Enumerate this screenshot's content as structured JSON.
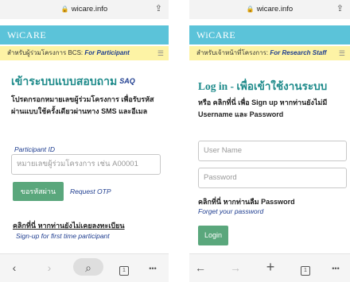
{
  "left": {
    "url": "wicare.info",
    "brand": "WiCARE",
    "role_thai": "สำหรับผู้ร่วมโครงการ BCS:",
    "role_label": "For Participant",
    "title": "เข้าระบบแบบสอบถาม",
    "title_badge": "SAQ",
    "desc": "โปรดกรอกหมายเลขผู้ร่วมโครงการ เพื่อรับรหัสผ่านแบบใช้ครั้งเดียวผ่านทาง SMS และอีเมล",
    "field_label": "Participant ID",
    "field_placeholder": "หมายเลขผู้ร่วมโครงการ เช่น A00001",
    "otp_button": "ขอรหัสผ่าน",
    "request_otp": "Request OTP",
    "register_thai": "คลิกที่นี่ หากท่านยังไม่เคยลงทะเบียน",
    "register_en": "Sign-up for first time participant"
  },
  "right": {
    "url": "wicare.info",
    "brand": "WiCARE",
    "role_thai": "สำหรับเจ้าหน้าที่โครงการ:",
    "role_label": "For Research Staff",
    "title": "Log in - เพื่อเข้าใช้งานระบบ",
    "subtitle": "หรือ คลิกที่นี่ เพื่อ Sign up หากท่านยังไม่มี Username และ Password",
    "username_placeholder": "User Name",
    "password_placeholder": "Password",
    "forgot_thai": "คลิกที่นี่ หากท่านลืม Password",
    "forgot_en": "Forget your password",
    "login_button": "Login"
  },
  "toolbar": {
    "back": "‹",
    "forward": "›",
    "search": "⌕",
    "new_tab": "+",
    "tabs_count": "1",
    "more": "•••"
  },
  "colors": {
    "brand_bar": "#5bc3d9",
    "role_bar": "#fdf3a5",
    "title": "#1d8a8a",
    "link": "#1d3c8f",
    "button": "#5aa77c"
  }
}
